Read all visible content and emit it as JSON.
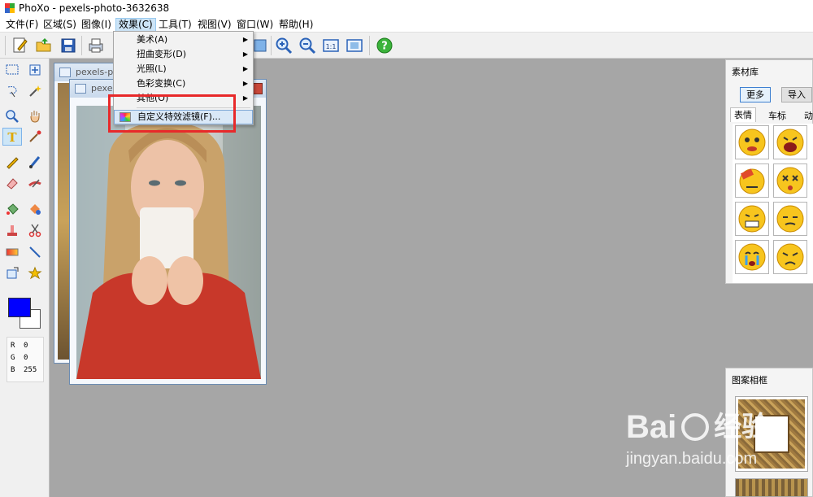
{
  "window": {
    "title": "PhoXo - pexels-photo-3632638"
  },
  "menu": [
    {
      "label": "文件(F)"
    },
    {
      "label": "区域(S)"
    },
    {
      "label": "图像(I)"
    },
    {
      "label": "效果(C)"
    },
    {
      "label": "工具(T)"
    },
    {
      "label": "视图(V)"
    },
    {
      "label": "窗口(W)"
    },
    {
      "label": "帮助(H)"
    }
  ],
  "effects_menu": {
    "items": [
      {
        "label": "美术(A)"
      },
      {
        "label": "扭曲变形(D)"
      },
      {
        "label": "光照(L)"
      },
      {
        "label": "色彩变换(C)"
      },
      {
        "label": "其他(O)"
      }
    ],
    "custom_filter": "自定义特效滤镜(F)..."
  },
  "documents": {
    "back_title": "pexels-ph",
    "front_title": "pexel"
  },
  "colors": {
    "foreground": "#0000ff",
    "background": "#ffffff",
    "highlight_box": "#e8292a"
  },
  "pixel_info": [
    {
      "channel": "R",
      "value": "0"
    },
    {
      "channel": "G",
      "value": "0"
    },
    {
      "channel": "B",
      "value": "255"
    }
  ],
  "material_panel": {
    "title": "素材库",
    "more_button": "更多",
    "import_button": "导入",
    "tabs": [
      "表情",
      "车标",
      "动"
    ]
  },
  "frame_panel": {
    "title": "图案相框"
  },
  "watermark": {
    "brand": "Bai",
    "brand_cn": "经验",
    "url": "jingyan.baidu.com"
  }
}
